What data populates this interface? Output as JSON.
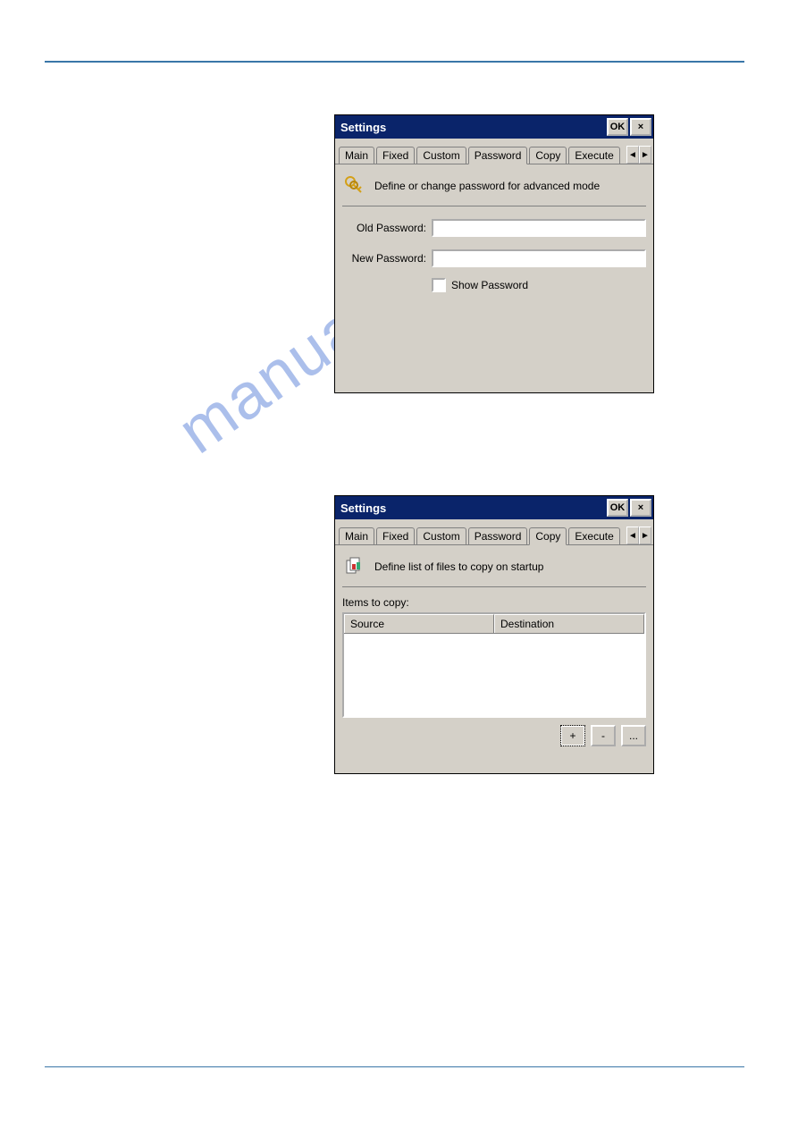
{
  "dialog1": {
    "title": "Settings",
    "ok": "OK",
    "close": "×",
    "tabs": [
      "Main",
      "Fixed",
      "Custom",
      "Password",
      "Copy",
      "Execute"
    ],
    "activeTab": "Password",
    "description": "Define or change password for advanced mode",
    "oldLabel": "Old Password:",
    "newLabel": "New Password:",
    "oldValue": "",
    "newValue": "",
    "showPassword": "Show Password",
    "scrollLeft": "◄",
    "scrollRight": "►"
  },
  "dialog2": {
    "title": "Settings",
    "ok": "OK",
    "close": "×",
    "tabs": [
      "Main",
      "Fixed",
      "Custom",
      "Password",
      "Copy",
      "Execute"
    ],
    "activeTab": "Copy",
    "description": "Define list of files to copy on startup",
    "listLabel": "Items to copy:",
    "colSource": "Source",
    "colDest": "Destination",
    "addBtn": "+",
    "removeBtn": "-",
    "moreBtn": "...",
    "scrollLeft": "◄",
    "scrollRight": "►"
  },
  "watermark": "manualshive.com"
}
